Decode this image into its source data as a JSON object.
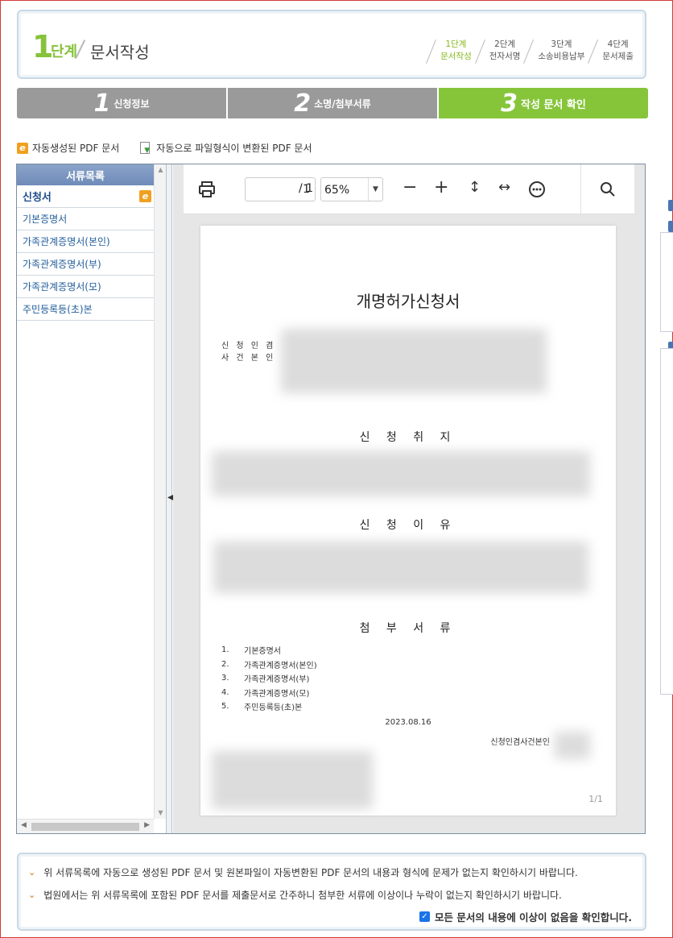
{
  "header": {
    "stage_number": "1",
    "stage_word": "단계",
    "stage_title": "문서작성",
    "steps": [
      {
        "line1": "1단계",
        "line2": "문서작성",
        "active": true
      },
      {
        "line1": "2단계",
        "line2": "전자서명",
        "active": false
      },
      {
        "line1": "3단계",
        "line2": "소송비용납부",
        "active": false
      },
      {
        "line1": "4단계",
        "line2": "문서제출",
        "active": false
      }
    ]
  },
  "tabs": [
    {
      "num": "1",
      "label": "신청정보"
    },
    {
      "num": "2",
      "label": "소명/첨부서류"
    },
    {
      "num": "3",
      "label": "작성 문서 확인"
    }
  ],
  "legend": {
    "auto_pdf_label": "자동생성된 PDF 문서",
    "converted_pdf_label": "자동으로 파일형식이 변환된 PDF 문서",
    "e_icon_char": "e"
  },
  "sidebar": {
    "title": "서류목록",
    "items": [
      {
        "label": "신청서",
        "active": true
      },
      {
        "label": "기본증명서",
        "active": false
      },
      {
        "label": "가족관계증명서(본인)",
        "active": false
      },
      {
        "label": "가족관계증명서(부)",
        "active": false
      },
      {
        "label": "가족관계증명서(모)",
        "active": false
      },
      {
        "label": "주민등록등(초)본",
        "active": false
      }
    ]
  },
  "pdf_toolbar": {
    "page_value": "1",
    "page_total": "/ 1",
    "zoom_value": "65%",
    "icons": [
      "print-icon",
      "zoom-out-icon",
      "zoom-in-icon",
      "fit-height-icon",
      "fit-width-icon",
      "more-icon",
      "search-icon"
    ]
  },
  "document": {
    "title": "개명허가신청서",
    "applicant_label_1": "신 청 인 겸",
    "applicant_label_2": "사 건 본 인",
    "section_purpose": "신 청 취 지",
    "section_reason": "신 청 이 유",
    "section_attachments": "첨 부 서 류",
    "attachments": [
      {
        "n": "1.",
        "label": "기본증명서"
      },
      {
        "n": "2.",
        "label": "가족관계증명서(본인)"
      },
      {
        "n": "3.",
        "label": "가족관계증명서(부)"
      },
      {
        "n": "4.",
        "label": "가족관계증명서(모)"
      },
      {
        "n": "5.",
        "label": "주민등록등(초)본"
      }
    ],
    "date": "2023.08.16",
    "signature_label": "신청인겸사건본인",
    "page_indicator": "1/1"
  },
  "confirm": {
    "notice_1": "위 서류목록에 자동으로 생성된 PDF 문서 및 원본파일이 자동변환된 PDF 문서의 내용과 형식에 문제가 없는지 확인하시기 바랍니다.",
    "notice_2": "법원에서는 위 서류목록에 포함된 PDF 문서를 제출문서로 간주하니 첨부한 서류에 이상이나 누락이 없는지 확인하시기 바랍니다.",
    "checkbox_label": "모든 문서의 내용에 이상이 없음을 확인합니다.",
    "checked": true
  },
  "colors": {
    "accent_green": "#86c53a",
    "tab_gray": "#9a9a9a",
    "link_blue": "#1f5c9a",
    "badge_orange": "#f0a020"
  }
}
